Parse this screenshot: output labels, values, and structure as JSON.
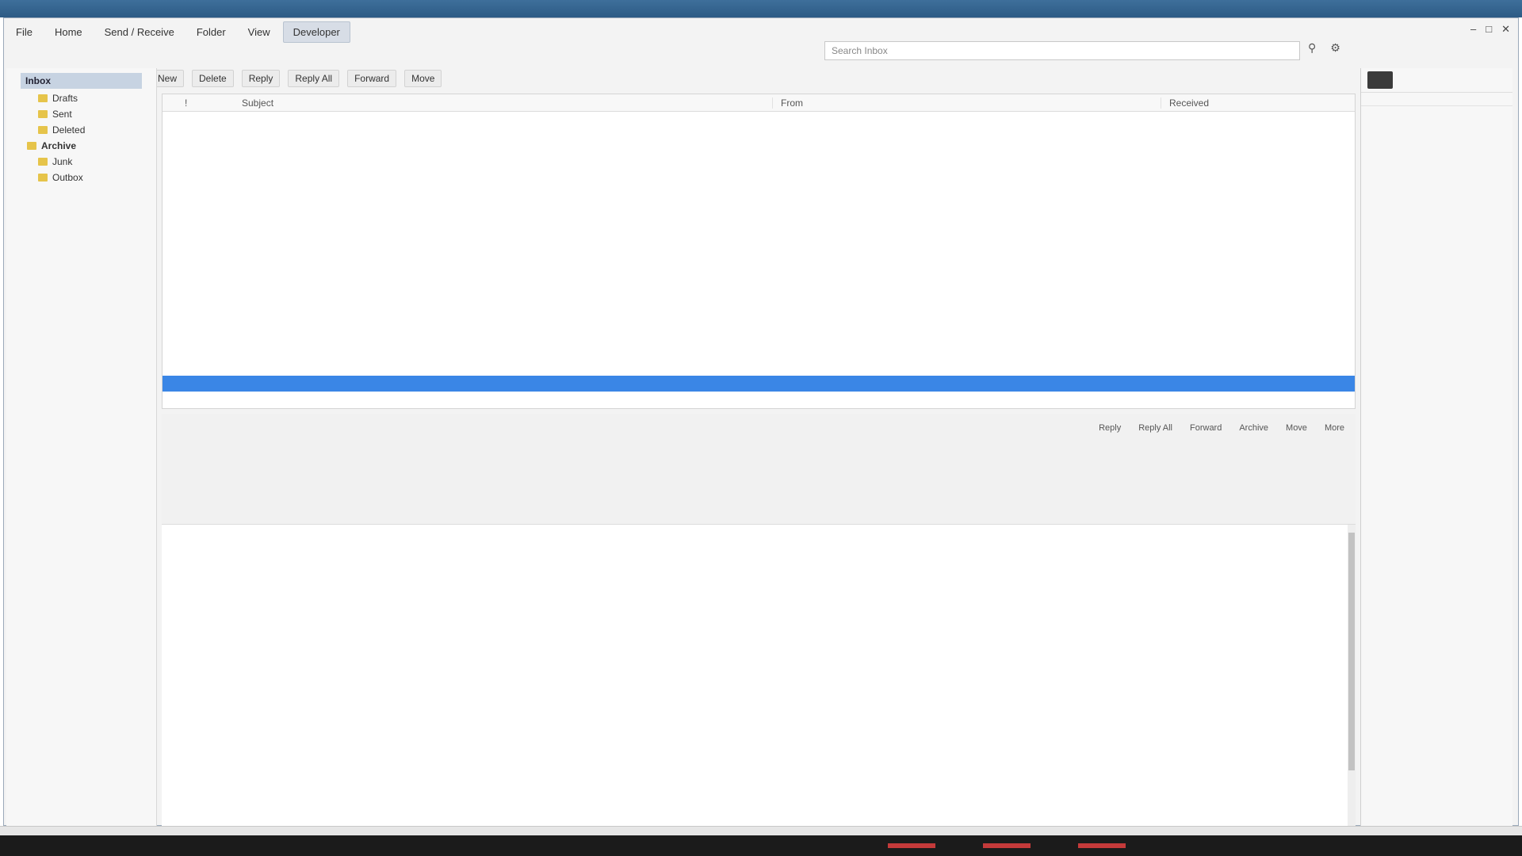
{
  "window": {
    "title": ""
  },
  "ribbon": {
    "tabs": [
      "File",
      "Home",
      "Send / Receive",
      "Folder",
      "View",
      "Developer"
    ],
    "active_index": 5,
    "search_placeholder": "Search Inbox"
  },
  "toolbar": {
    "buttons": [
      "New",
      "Delete",
      "Reply",
      "Reply All",
      "Forward",
      "Move"
    ],
    "note": ""
  },
  "folders": {
    "account": "Inbox",
    "items": [
      {
        "label": "Drafts",
        "group": false
      },
      {
        "label": "Sent",
        "group": false
      },
      {
        "label": "Deleted",
        "group": false
      },
      {
        "label": "Archive",
        "group": true
      },
      {
        "label": "Junk",
        "group": false
      },
      {
        "label": "Outbox",
        "group": false
      }
    ]
  },
  "list": {
    "headers": {
      "flag": "!",
      "subject": "Subject",
      "from": "From",
      "date": "Received"
    },
    "rows": [
      {
        "subject": "",
        "from": "",
        "date": "",
        "state": "normal"
      },
      {
        "subject": "",
        "from": "",
        "date": "",
        "state": "normal"
      },
      {
        "subject": "",
        "from": "",
        "date": "",
        "state": "normal"
      },
      {
        "subject": "",
        "from": "",
        "date": "",
        "state": "normal"
      },
      {
        "subject": "",
        "from": "",
        "date": "",
        "state": "normal"
      },
      {
        "subject": "",
        "from": "",
        "date": "",
        "state": "normal"
      },
      {
        "subject": "",
        "from": "",
        "date": "",
        "state": "normal"
      },
      {
        "subject": "",
        "from": "",
        "date": "",
        "state": "normal"
      },
      {
        "subject": "",
        "from": "",
        "date": "",
        "state": "normal"
      },
      {
        "subject": "",
        "from": "",
        "date": "",
        "state": "normal"
      },
      {
        "subject": "",
        "from": "",
        "date": "",
        "state": "normal"
      },
      {
        "subject": "",
        "from": "",
        "date": "",
        "state": "normal"
      },
      {
        "subject": "",
        "from": "",
        "date": "",
        "state": "normal"
      },
      {
        "subject": "",
        "from": "",
        "date": "",
        "state": "normal"
      },
      {
        "subject": "",
        "from": "",
        "date": "",
        "state": "highlight"
      },
      {
        "subject": "",
        "from": "",
        "date": "",
        "state": "normal"
      },
      {
        "subject": "",
        "from": "",
        "date": "",
        "state": "normal"
      },
      {
        "subject": "",
        "from": "",
        "date": "",
        "state": "selected"
      }
    ]
  },
  "reading": {
    "subject": "",
    "from_line": "",
    "to_line": "",
    "cc_line": "",
    "extra_line": "",
    "time": "",
    "actions": [
      "Reply",
      "Reply All",
      "Forward",
      "Archive",
      "Move",
      "More"
    ],
    "body": [
      "",
      ""
    ],
    "link1": "",
    "link2": "",
    "meeting_label": "",
    "meeting_link": "",
    "sig_name": "",
    "sig_org": "",
    "sig_lines": [
      "",
      "",
      ""
    ],
    "phone_lines": [
      "",
      ""
    ],
    "email_link": "",
    "web_link": "",
    "footer": ""
  },
  "right_pane": {
    "title": "",
    "section": "",
    "items": [
      "",
      "",
      ""
    ]
  },
  "colors": {
    "selection": "#3a86e6",
    "highlight": "#e08a12",
    "link": "#2b55d9"
  }
}
